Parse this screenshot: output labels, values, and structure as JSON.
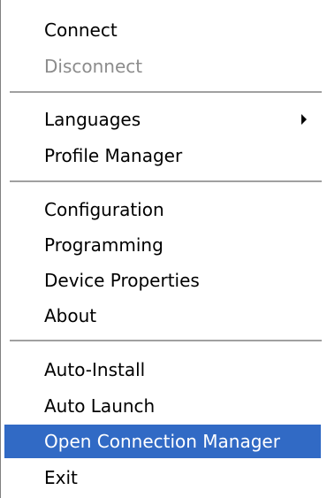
{
  "menu": {
    "items": [
      {
        "label": "Connect"
      },
      {
        "label": "Disconnect"
      },
      {
        "label": "Languages"
      },
      {
        "label": "Profile Manager"
      },
      {
        "label": "Configuration"
      },
      {
        "label": "Programming"
      },
      {
        "label": "Device Properties"
      },
      {
        "label": "About"
      },
      {
        "label": "Auto-Install"
      },
      {
        "label": "Auto Launch"
      },
      {
        "label": "Open Connection Manager"
      },
      {
        "label": "Exit"
      }
    ],
    "disabled_items": [
      "Disconnect"
    ],
    "highlighted_item": "Open Connection Manager",
    "submenu_items": [
      "Languages"
    ]
  },
  "colors": {
    "highlight_background": "#316ac5",
    "highlight_text": "#ffffff",
    "disabled_text": "#8c8c8c",
    "separator": "#a0a0a0"
  }
}
